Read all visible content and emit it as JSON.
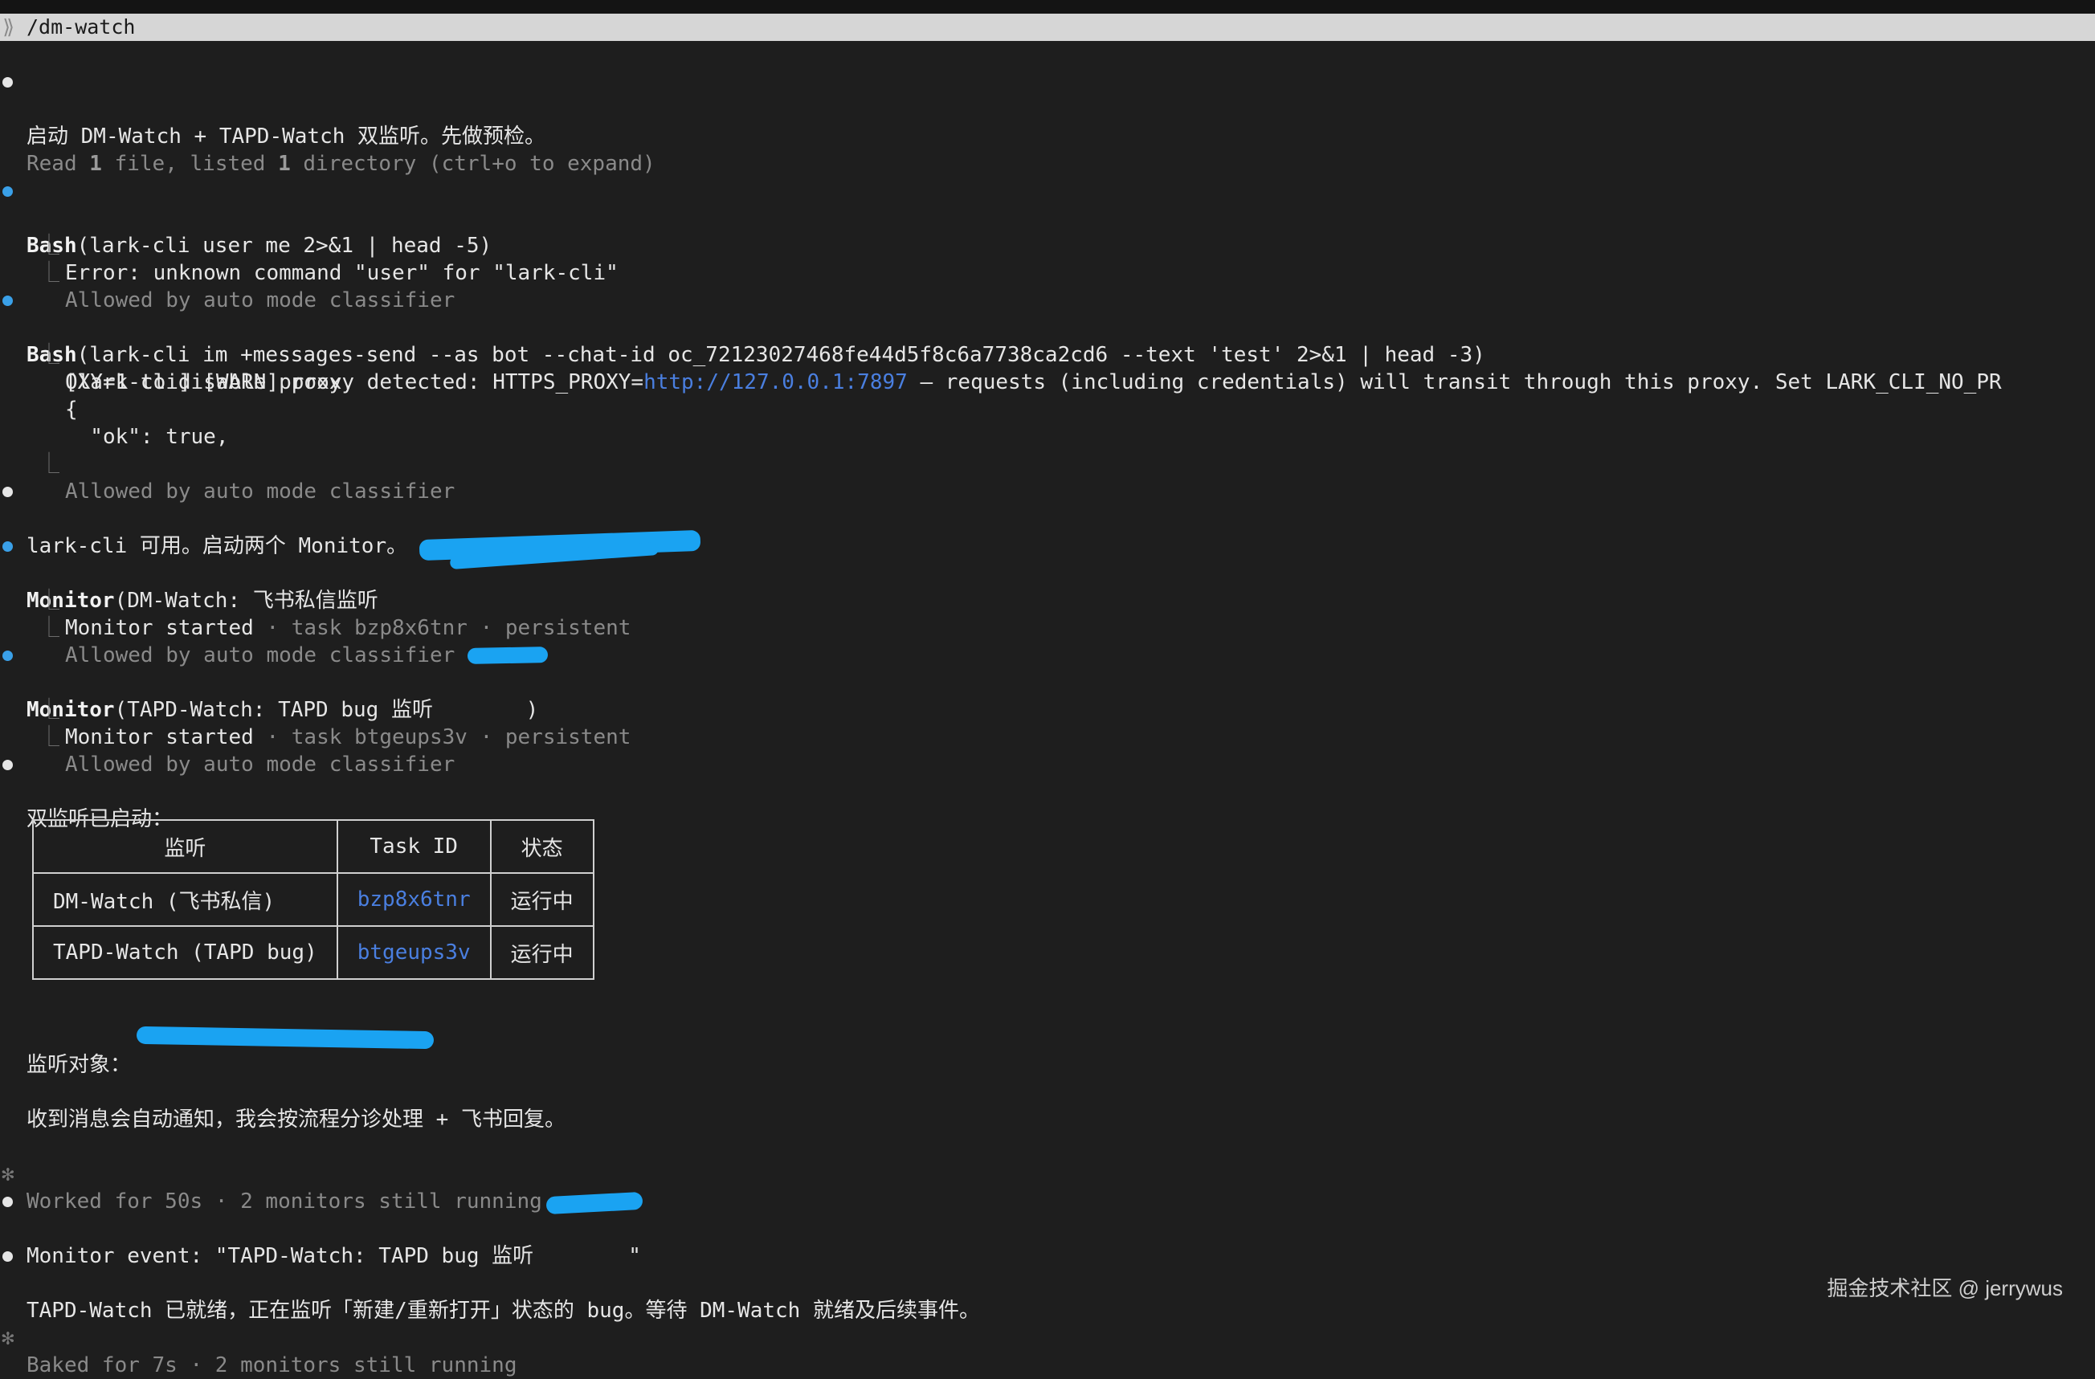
{
  "prompt": {
    "caret": "⟫",
    "command": "/dm-watch"
  },
  "messages": {
    "m1": "启动 DM-Watch + TAPD-Watch 双监听。先做预检。",
    "read_summary": {
      "pre": "Read ",
      "n1": "1",
      "mid": " file, listed ",
      "n2": "1",
      "post": " directory (ctrl+o to expand)"
    },
    "bash1": {
      "tool": "Bash",
      "args": "(lark-cli user me 2>&1 | head -5)",
      "output": "Error: unknown command \"user\" for \"lark-cli\"",
      "allowed": "Allowed by auto mode classifier"
    },
    "bash2": {
      "tool": "Bash",
      "args": "(lark-cli im +messages-send --as bot --chat-id oc_72123027468fe44d5f8c6a7738ca2cd6 --text 'test' 2>&1 | head -3)",
      "out_pre": "[lark-cli] [WARN] proxy detected: HTTPS_PROXY=",
      "out_link": "http://127.0.0.1:7897",
      "out_post": " — requests (including credentials) will transit through this proxy. Set LARK_CLI_NO_PR",
      "out_line2": "OXY=1 to disable proxy.",
      "out_line3": "{",
      "out_line4": "  \"ok\": true,",
      "allowed": "Allowed by auto mode classifier"
    },
    "m2": "lark-cli 可用。启动两个 Monitor。",
    "monitor1": {
      "tool": "Monitor",
      "args": "(DM-Watch: 飞书私信监听 ",
      "started": "Monitor started",
      "meta": " · task bzp8x6tnr · persistent",
      "allowed": "Allowed by auto mode classifier"
    },
    "monitor2": {
      "tool": "Monitor",
      "args": "(TAPD-Watch: TAPD bug 监听 ",
      "args_close": ")",
      "started": "Monitor started",
      "meta": " · task btgeups3v · persistent",
      "allowed": "Allowed by auto mode classifier"
    },
    "m3": "双监听已启动：",
    "table": {
      "headers": [
        "监听",
        "Task ID",
        "状态"
      ],
      "rows": [
        {
          "name": "DM-Watch (飞书私信)",
          "task": "bzp8x6tnr",
          "status": "运行中"
        },
        {
          "name": "TAPD-Watch (TAPD bug)",
          "task": "btgeups3v",
          "status": "运行中"
        }
      ]
    },
    "target_label": "监听对象：",
    "m4": "收到消息会自动通知，我会按流程分诊处理 + 飞书回复。",
    "worked": "Worked for 50s · 2 monitors still running",
    "event_pre": "Monitor event: \"TAPD-Watch: TAPD bug 监听",
    "event_post": "\"",
    "m5": "TAPD-Watch 已就绪，正在监听「新建/重新打开」状态的 bug。等待 DM-Watch 就绪及后续事件。",
    "baked": "Baked for 7s · 2 monitors still running",
    "star": "✻",
    "elbow": "⎿"
  },
  "watermark": "掘金技术社区 @ jerrywus",
  "colors": {
    "background": "#1e1e1e",
    "prompt_bar": "#d6d6d6",
    "tool_dot": "#3aa0e8",
    "link": "#4a7fe0",
    "dim_text": "#8a8a8a"
  }
}
